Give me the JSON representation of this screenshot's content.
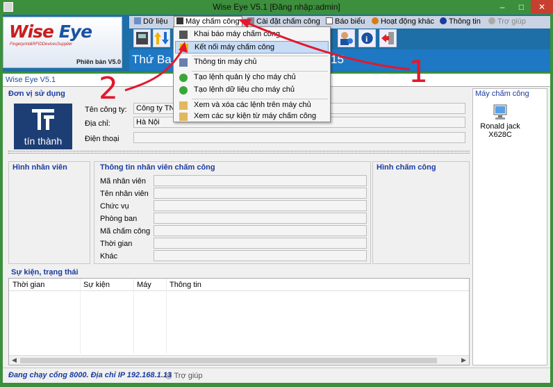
{
  "window": {
    "title": "Wise Eye V5.1 [Đăng nhập:admin]",
    "minimize": "–",
    "maximize": "□",
    "close": "✕"
  },
  "logo": {
    "brand_a": "Wise",
    "brand_b": "Eye",
    "tagline": "Fingerprint&RFIDDevicesSupplier",
    "version": "Phiên bản V5.0"
  },
  "menu": [
    {
      "label": "Dữ liệu",
      "icon": "data-icon"
    },
    {
      "label": "Máy chấm công",
      "icon": "device-icon"
    },
    {
      "label": "Cài đặt chấm công",
      "icon": "settings-icon"
    },
    {
      "label": "Báo biểu",
      "icon": "report-icon"
    },
    {
      "label": "Hoạt động khác",
      "icon": "activity-icon"
    },
    {
      "label": "Thông tin",
      "icon": "info-icon"
    },
    {
      "label": "Trợ giúp",
      "icon": "help-icon"
    }
  ],
  "date_text_a": "Thứ Ba,",
  "date_text_b": "15",
  "dropdown": [
    "Khai báo máy chấm công",
    "Kết nối máy chấm công",
    "Thông tin máy chủ",
    "Tạo lệnh quản lý cho máy chủ",
    "Tạo lệnh dữ liệu cho máy chủ",
    "Xem và xóa các lệnh trên máy chủ",
    "Xem các sự kiện từ máy chấm công"
  ],
  "inner_title": "Wise Eye V5.1",
  "company": {
    "section": "Đơn vị sử dụng",
    "logo_name": "tín thành",
    "name_label": "Tên công ty:",
    "name_value": "Công ty TNH",
    "address_label": "Địa chỉ:",
    "address_value": "Hà Nội",
    "phone_label": "Điện thoại",
    "phone_value": ""
  },
  "employee": {
    "photo_section": "Hình nhân viên",
    "info_section": "Thông tin nhân viên chấm công",
    "checkin_section": "Hình chấm công",
    "fields": [
      "Mã nhân viên",
      "Tên nhân viên",
      "Chức vụ",
      "Phòng ban",
      "Mã chấm công",
      "Thời gian",
      "Khác"
    ]
  },
  "devices": {
    "header": "Máy chấm công",
    "items": [
      {
        "name": "Ronald jack",
        "model": "X628C"
      }
    ]
  },
  "events": {
    "section": "Sự kiện, trạng thái",
    "columns": [
      "Thời gian",
      "Sự kiện",
      "Máy",
      "Thông tin"
    ]
  },
  "status": {
    "text": "Đang chạy cổng 8000. Địa chỉ IP 192.168.1.13",
    "help": "Trợ giúp"
  },
  "annotations": [
    "1",
    "2"
  ],
  "colors": {
    "titlebar": "#3c8f3c",
    "header": "#1e6fa8",
    "accent_text": "#1a3aa0",
    "annotation": "#e3182d"
  }
}
